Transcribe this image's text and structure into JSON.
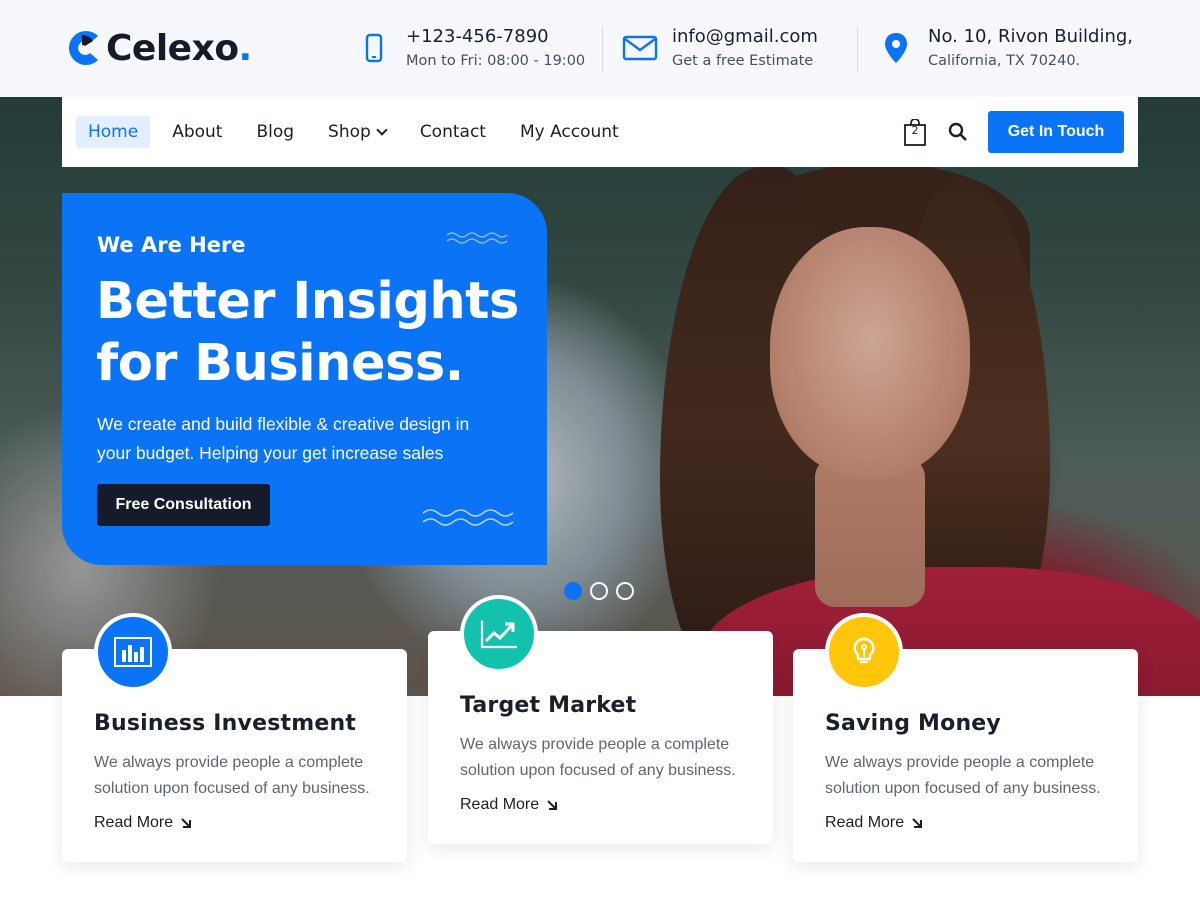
{
  "brand": {
    "name": "Celexo",
    "dot": ".",
    "accent": "#0b74f6"
  },
  "contacts": {
    "phone": {
      "line1": "+123-456-7890",
      "line2": "Mon to Fri: 08:00 - 19:00",
      "icon": "phone-icon"
    },
    "email": {
      "line1": "info@gmail.com",
      "line2": "Get a free Estimate",
      "icon": "mail-icon"
    },
    "address": {
      "line1": "No. 10, Rivon Building,",
      "line2": "California, TX 70240.",
      "icon": "location-pin-icon"
    }
  },
  "nav": {
    "items": [
      "Home",
      "About",
      "Blog",
      "Shop",
      "Contact",
      "My Account"
    ],
    "active": "Home",
    "cart_count": "2",
    "cta": "Get In Touch"
  },
  "hero": {
    "eyebrow": "We Are Here",
    "title": "Better Insights for Business.",
    "description": "We create and build flexible & creative design in your budget. Helping your get increase sales",
    "button": "Free Consultation",
    "slides_total": 3,
    "active_slide": 1
  },
  "features": [
    {
      "title": "Business Investment",
      "desc": "We always provide people a complete solution upon focused of any business.",
      "link": "Read More",
      "icon": "bar-chart-icon",
      "color": "#0b74f6"
    },
    {
      "title": "Target Market",
      "desc": "We always provide people a complete solution upon focused of any business.",
      "link": "Read More",
      "icon": "trending-up-icon",
      "color": "#12c2ad"
    },
    {
      "title": "Saving Money",
      "desc": "We always provide people a complete solution upon focused of any business.",
      "link": "Read More",
      "icon": "lightbulb-icon",
      "color": "#ffc60a"
    }
  ]
}
